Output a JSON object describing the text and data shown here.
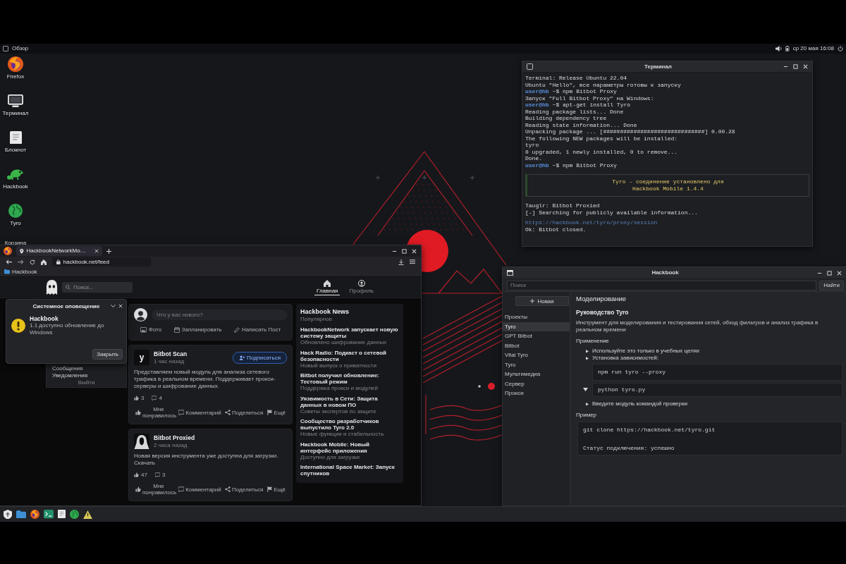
{
  "top_bar": {
    "label": "Обзор",
    "clock": "ср 20 мая 16:08"
  },
  "desktop_icons": [
    {
      "kind": "browser",
      "label": "Firefox"
    },
    {
      "kind": "terminal",
      "label": "Терминал"
    },
    {
      "kind": "notes",
      "label": "Блокнот"
    },
    {
      "kind": "chameleon",
      "label": "Hackbook"
    },
    {
      "kind": "globe",
      "label": "Tyro"
    },
    {
      "kind": "label",
      "label": "Корзина"
    }
  ],
  "terminal": {
    "title": "Терминал",
    "lines": [
      {
        "kind": "output",
        "text": "Terminal: Release Ubuntu 22.04"
      },
      {
        "kind": "output",
        "text": "Ubuntu \"Hello\", все параметры готовы к запуску"
      },
      {
        "kind": "prompt",
        "prompt": "user@hb",
        "text": "~$ npm Bitbot Proxy"
      },
      {
        "kind": "output",
        "text": "Запуск \"Full Bitbot Proxy\" на Windows:"
      },
      {
        "kind": "prompt",
        "prompt": "user@hb",
        "text": "~$ apt-get install Tyro"
      },
      {
        "kind": "output",
        "text": "Reading package lists... Done"
      },
      {
        "kind": "output",
        "text": "Building dependency tree"
      },
      {
        "kind": "output",
        "text": "Reading state information... Done"
      },
      {
        "kind": "output",
        "text": "Unpacking package ... [##############################] 0.00.28"
      },
      {
        "kind": "output",
        "text": "The following NEW packages will be installed:"
      },
      {
        "kind": "output",
        "text": "tyro"
      },
      {
        "kind": "output",
        "text": "0 upgraded, 1 newly installed, 0 to remove..."
      },
      {
        "kind": "output",
        "text": "Done."
      },
      {
        "kind": "prompt",
        "prompt": "user@hb",
        "text": "~$ npm Bitbot Proxy"
      }
    ],
    "banner": [
      "Tyro - соединение установлено для",
      "Hackbook Mobile 1.4.4"
    ],
    "after": [
      {
        "kind": "output",
        "text": "Tauglr: Bitbot Proxied"
      },
      {
        "kind": "output",
        "text": "[-] Searching for publicly available information..."
      },
      {
        "kind": "link",
        "text": "https://hackbook.net/tyro/proxy/session"
      },
      {
        "kind": "output",
        "text": "Ok: Bitbot closed."
      }
    ]
  },
  "browser": {
    "tab_title": "HackbookNetworkMo…",
    "url": "hackbook.net/feed",
    "bookmark": "Hackbook",
    "site": {
      "search_placeholder": "Поиск...",
      "nav": [
        {
          "kind": "home",
          "label": "Главная",
          "selected": true
        },
        {
          "kind": "profile",
          "label": "Профиль",
          "selected": false
        }
      ]
    },
    "notification": {
      "title": "Системное оповещение",
      "app": "Hackbook",
      "message": "1.1 доступно обновление до Windows",
      "button": "Закрыть"
    },
    "menu": {
      "items": [
        "Сообщения",
        "Уведомления"
      ],
      "logout": "Выйти"
    },
    "composer": {
      "placeholder": "Что у вас нового?",
      "actions": [
        {
          "kind": "photo",
          "label": "Фото"
        },
        {
          "kind": "calendar",
          "label": "Запланировать"
        },
        {
          "kind": "edit",
          "label": "Написать Пост"
        }
      ]
    },
    "posts": [
      {
        "author": "Bitbot Scan",
        "time": "1 час назад",
        "avatar": {
          "kind": "letter",
          "text": "y"
        },
        "follow": "Подписаться",
        "text": "Представляем новый модуль для анализа сетевого трафика в реальном времени. Поддерживает прокси-серверы и шифрование данных.",
        "likes": "3",
        "comments": "4",
        "actions": [
          {
            "kind": "like",
            "label": "Мне понравилось"
          },
          {
            "kind": "comment",
            "label": "Комментарий"
          },
          {
            "kind": "share",
            "label": "Поделиться"
          },
          {
            "kind": "more",
            "label": "Ещё"
          }
        ]
      },
      {
        "author": "Bitbot Proxied",
        "time": "2 часа назад",
        "avatar": {
          "kind": "hooded"
        },
        "text": "Новая версия инструмента уже доступна для загрузки. Скачать",
        "likes": "47",
        "comments": "3",
        "actions": [
          {
            "kind": "like",
            "label": "Мне понравилось"
          },
          {
            "kind": "comment",
            "label": "Комментарий"
          },
          {
            "kind": "share",
            "label": "Поделиться"
          },
          {
            "kind": "more",
            "label": "Ещё"
          }
        ]
      }
    ],
    "news": {
      "title": "Hackbook News",
      "subtitle": "Популярное",
      "items": [
        {
          "title": "HackbookNetwork запускает новую систему защиты",
          "desc": "Обновлено шифрование данных"
        },
        {
          "title": "Hack Radio: Подкаст о сетевой безопасности",
          "desc": "Новый выпуск о приватности"
        },
        {
          "title": "Bitbot получил обновление: Тестовый режим",
          "desc": "Поддержка прокси и модулей"
        },
        {
          "title": "Уязвимость в Сети: Защита данных в новом ПО",
          "desc": "Советы экспертов по защите"
        },
        {
          "title": "Сообщество разработчиков выпустило Tyro 2.0",
          "desc": "Новые функции и стабильность"
        },
        {
          "title": "Hackbook Mobile: Новый интерфейс приложения",
          "desc": "Доступно для загрузки"
        },
        {
          "title": "International Space Market: Запуск спутников"
        }
      ]
    }
  },
  "wiki": {
    "title": "Hackbook",
    "search_placeholder": "Поиск",
    "search_button": "Найти",
    "new_button": "Новая",
    "sidebar": [
      {
        "label": "Проекты",
        "selected": false
      },
      {
        "label": "Tyro",
        "selected": true
      },
      {
        "label": "GPT Bitbot",
        "selected": false
      },
      {
        "label": "Bitbot",
        "selected": false
      },
      {
        "label": "Vital Tyro",
        "selected": false
      },
      {
        "label": "Tyro",
        "selected": false
      },
      {
        "label": "Мультимедиа",
        "selected": false
      },
      {
        "label": "Сервер",
        "selected": false
      },
      {
        "label": "Прокси",
        "selected": false
      }
    ],
    "content": [
      {
        "kind": "title",
        "text": "Моделирование"
      },
      {
        "kind": "subtitle",
        "text": "Руководство Tyro"
      },
      {
        "kind": "paragraph",
        "text": "Инструмент для моделирования и тестирования сетей, обход фильтров и анализ трафика в реальном времени"
      },
      {
        "kind": "section",
        "text": "Применение"
      },
      {
        "kind": "bullet",
        "text": "Используйте это только в учебных целях"
      },
      {
        "kind": "bullet",
        "text": "Установка зависимостей:"
      },
      {
        "kind": "code",
        "lines": [
          "npm run tyro --proxy"
        ]
      },
      {
        "kind": "collapsible",
        "text": "python tyro.py",
        "expanded": true
      },
      {
        "kind": "bullet",
        "text": "Введите модуль командой проверки"
      },
      {
        "kind": "section",
        "text": "Пример"
      },
      {
        "kind": "code",
        "lines": [
          "git clone https://hackbook.net/tyro.git",
          "Статус подключения: успешно"
        ]
      }
    ]
  },
  "taskbar": [
    {
      "kind": "start"
    },
    {
      "kind": "files"
    },
    {
      "kind": "browser"
    },
    {
      "kind": "terminal"
    },
    {
      "kind": "notes"
    },
    {
      "kind": "network"
    },
    {
      "kind": "alerts"
    }
  ]
}
